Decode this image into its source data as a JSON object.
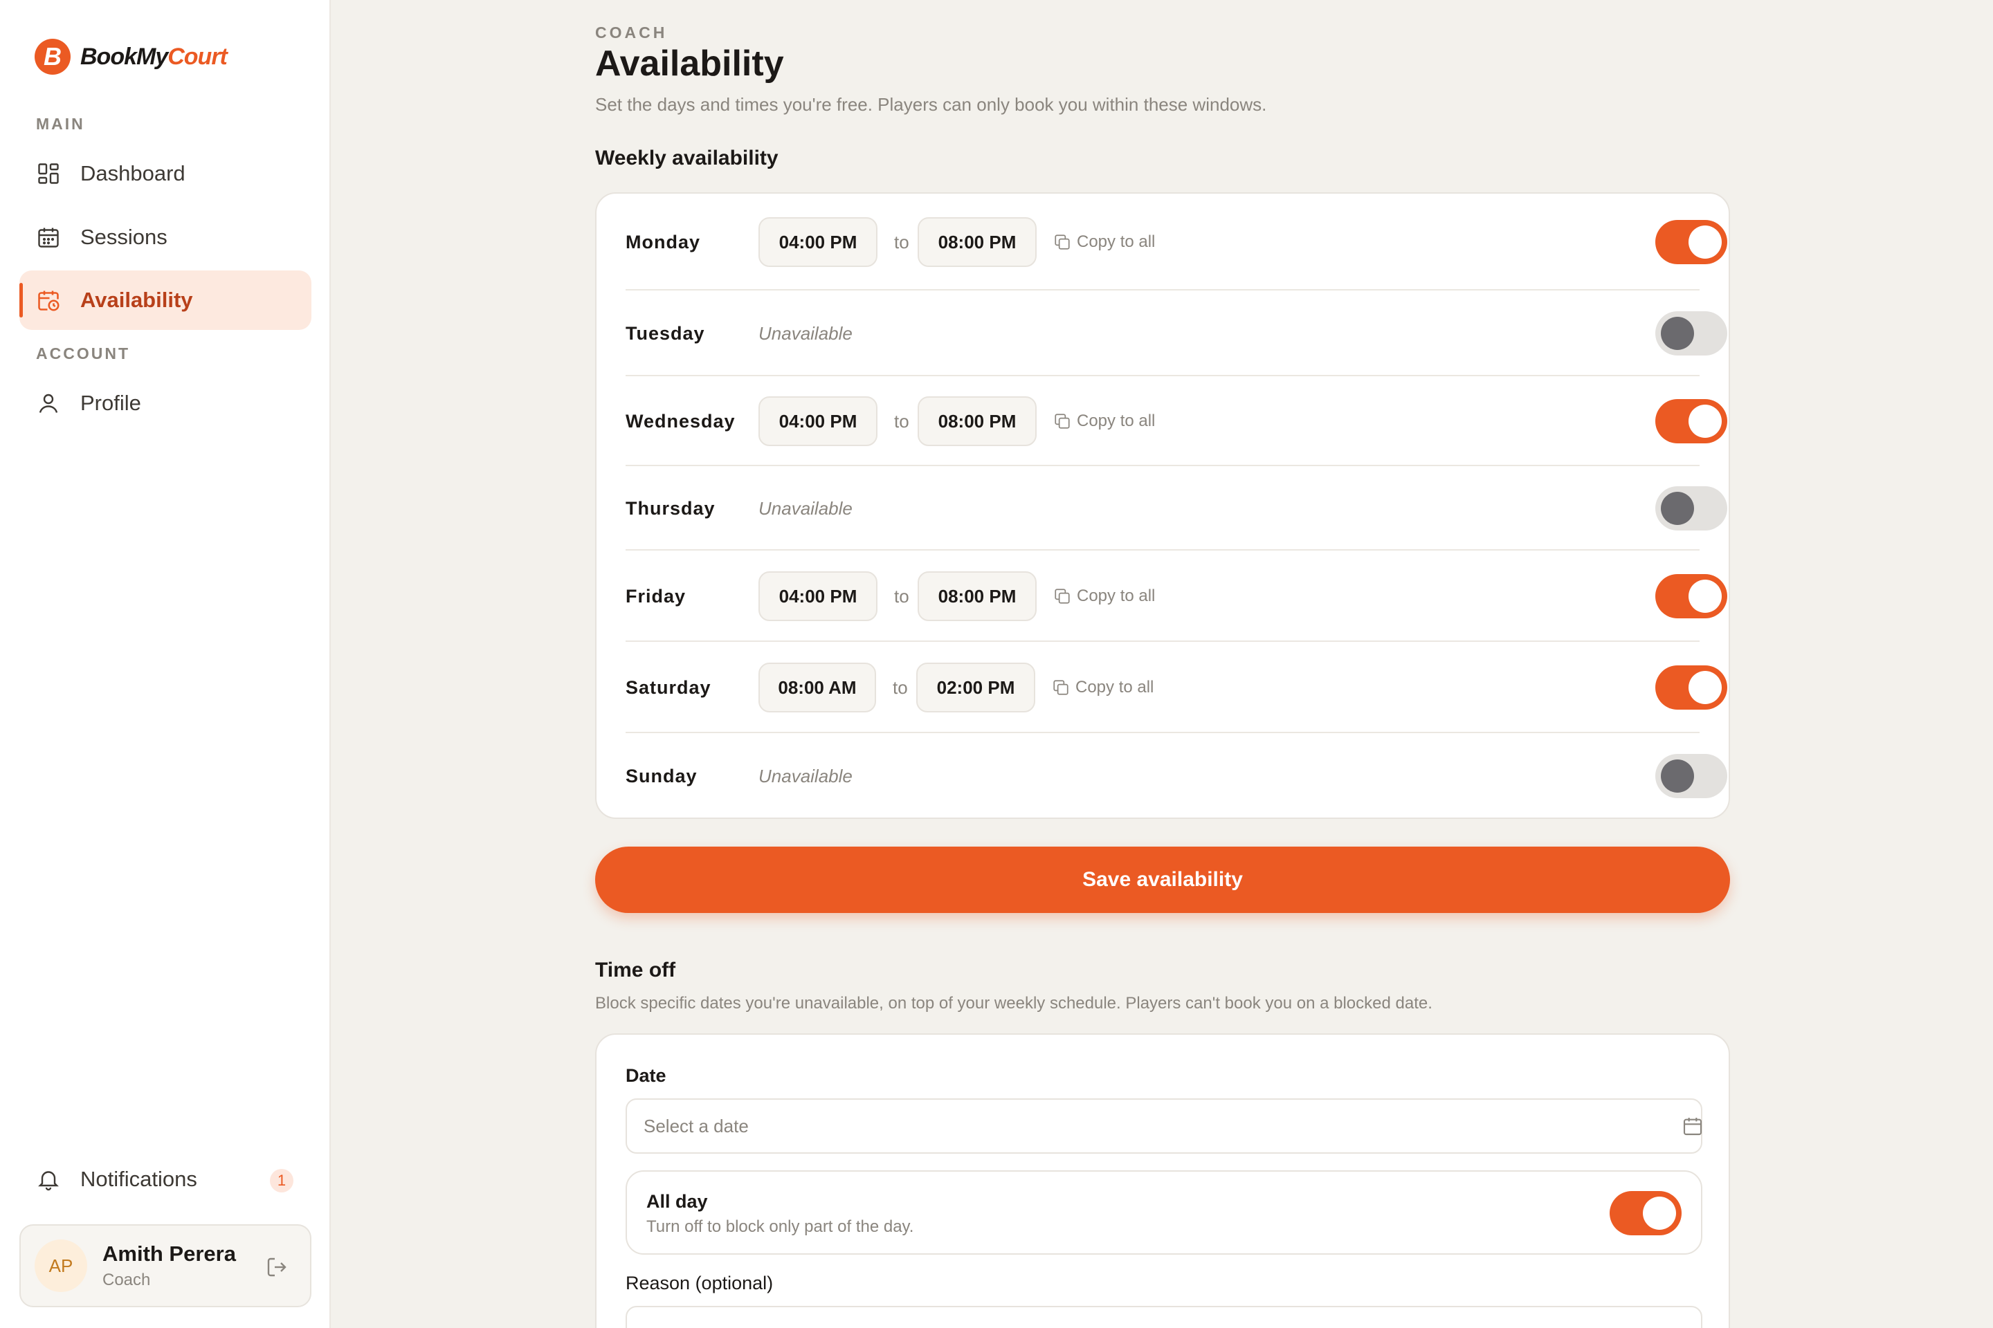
{
  "brand": {
    "mark": "B",
    "name_dark": "BookMy",
    "name_accent": "Court",
    "accent_color": "#eb5a23"
  },
  "sidebar": {
    "section_main": "MAIN",
    "section_account": "ACCOUNT",
    "items": [
      {
        "label": "Dashboard",
        "icon": "dashboard-icon"
      },
      {
        "label": "Sessions",
        "icon": "calendar-icon"
      },
      {
        "label": "Availability",
        "icon": "calendar-clock-icon",
        "active": true
      },
      {
        "label": "Profile",
        "icon": "user-icon"
      }
    ],
    "notifications": {
      "label": "Notifications",
      "count": "1",
      "icon": "bell-icon"
    },
    "user": {
      "initials": "AP",
      "name": "Amith Perera",
      "role": "Coach",
      "logout_icon": "logout-icon"
    }
  },
  "header": {
    "eyebrow": "COACH",
    "title": "Availability",
    "subtitle": "Set the days and times you're free. Players can only book you within these windows."
  },
  "weekly": {
    "title": "Weekly availability",
    "to_label": "to",
    "copy_label": "Copy to all",
    "unavailable_label": "Unavailable",
    "days": [
      {
        "name": "Monday",
        "enabled": true,
        "start": "04:00 PM",
        "end": "08:00 PM"
      },
      {
        "name": "Tuesday",
        "enabled": false
      },
      {
        "name": "Wednesday",
        "enabled": true,
        "start": "04:00 PM",
        "end": "08:00 PM"
      },
      {
        "name": "Thursday",
        "enabled": false
      },
      {
        "name": "Friday",
        "enabled": true,
        "start": "04:00 PM",
        "end": "08:00 PM"
      },
      {
        "name": "Saturday",
        "enabled": true,
        "start": "08:00 AM",
        "end": "02:00 PM"
      },
      {
        "name": "Sunday",
        "enabled": false
      }
    ],
    "save_label": "Save availability"
  },
  "time_off": {
    "title": "Time off",
    "subtitle": "Block specific dates you're unavailable, on top of your weekly schedule. Players can't book you on a blocked date.",
    "date_label": "Date",
    "date_placeholder": "Select a date",
    "all_day_title": "All day",
    "all_day_sub": "Turn off to block only part of the day.",
    "all_day_enabled": true,
    "reason_label": "Reason (optional)"
  }
}
